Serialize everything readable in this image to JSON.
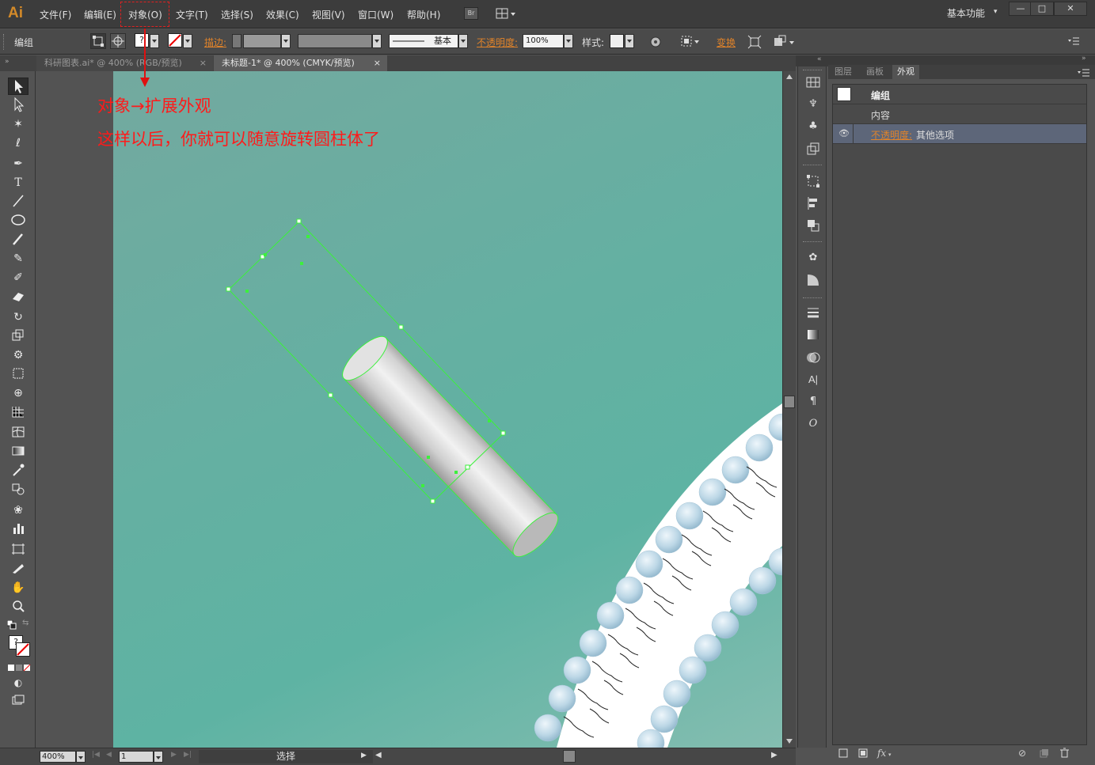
{
  "app": {
    "logo": "Ai"
  },
  "menu": {
    "items": [
      "文件(F)",
      "编辑(E)",
      "对象(O)",
      "文字(T)",
      "选择(S)",
      "效果(C)",
      "视图(V)",
      "窗口(W)",
      "帮助(H)"
    ],
    "bridge_label": "Br",
    "workspace": "基本功能",
    "window_buttons": [
      "—",
      "□",
      "✕"
    ]
  },
  "control_bar": {
    "selection_label": "编组",
    "stroke_label": "描边:",
    "stroke_profile": "基本",
    "opacity_label": "不透明度:",
    "opacity_value": "100%",
    "style_label": "样式:",
    "transform_label": "变换"
  },
  "tabs": [
    {
      "label": "科研图表.ai* @ 400% (RGB/预览)",
      "active": false
    },
    {
      "label": "未标题-1* @ 400% (CMYK/预览)",
      "active": true
    }
  ],
  "annotations": {
    "line1": "对象→扩展外观",
    "line2": "这样以后，你就可以随意旋转圆柱体了"
  },
  "appearance_panel": {
    "tabs": [
      "图层",
      "画板",
      "外观"
    ],
    "active_tab": "外观",
    "header": "编组",
    "rows": [
      {
        "label": "内容"
      },
      {
        "label_orange": "不透明度:",
        "label": "其他选项"
      }
    ],
    "bottom_icons": [
      "new-art-icon",
      "clear-icon",
      "fx-icon",
      "no-icon",
      "duplicate-icon",
      "trash-icon"
    ]
  },
  "status_bar": {
    "zoom": "400%",
    "artboard": "1",
    "tool": "选择"
  },
  "colors": {
    "accent_orange": "#e0832a",
    "annotation_red": "#ff1a1a",
    "selection_green": "#3cf03c",
    "canvas_teal": "#62b0a2"
  }
}
